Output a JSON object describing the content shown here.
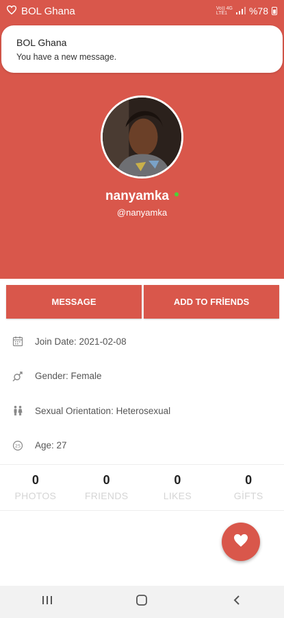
{
  "status_bar": {
    "app_name": "BOL Ghana",
    "network_top": "Vo)) 4G",
    "network_bottom": "LTE1",
    "battery": "%78"
  },
  "notification": {
    "title": "BOL Ghana",
    "text": "You have a new message."
  },
  "profile": {
    "username": "nanyamka",
    "handle": "@nanyamka",
    "online": true
  },
  "actions": {
    "message_label": "MESSAGE",
    "add_friend_label": "ADD TO FRİENDS"
  },
  "info": {
    "join_date": "Join Date: 2021-02-08",
    "gender": "Gender: Female",
    "orientation": "Sexual Orientation: Heterosexual",
    "age": "Age: 27"
  },
  "stats": [
    {
      "count": "0",
      "label": "PHOTOS"
    },
    {
      "count": "0",
      "label": "FRIENDS"
    },
    {
      "count": "0",
      "label": "LIKES"
    },
    {
      "count": "0",
      "label": "GİFTS"
    }
  ],
  "icons": {
    "fab": "heart-icon",
    "nav": [
      "recent-apps-icon",
      "home-icon",
      "back-icon"
    ]
  },
  "colors": {
    "accent": "#d9574b",
    "online": "#4cd137",
    "stat_label": "#d5d5d5"
  }
}
